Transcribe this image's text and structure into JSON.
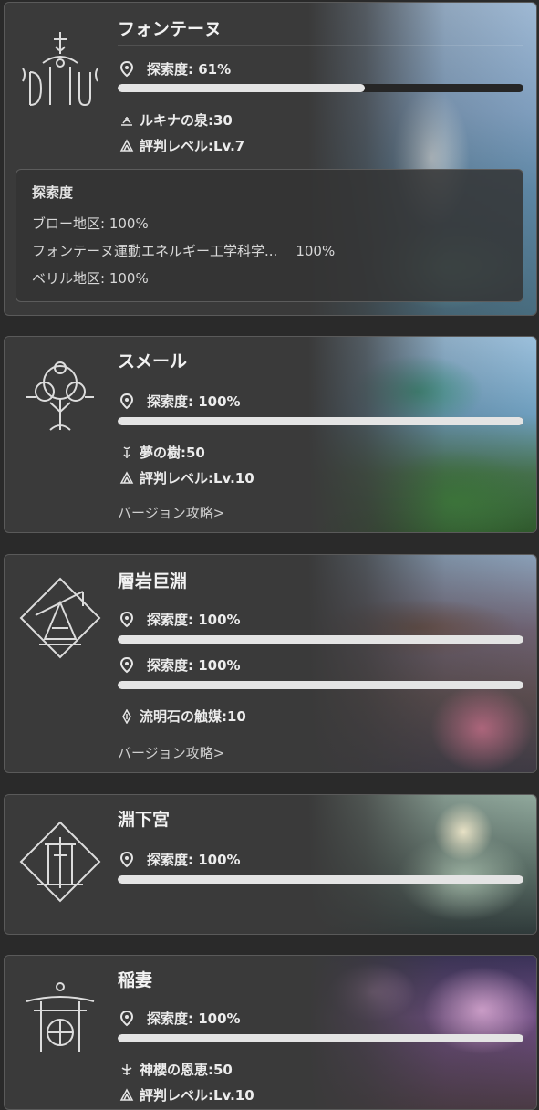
{
  "regions": [
    {
      "title": "フォンテーヌ",
      "exploration": [
        {
          "label": "探索度: 61%",
          "progress": 0.61
        }
      ],
      "stats": [
        {
          "icon": "lotus-fountain-icon",
          "label": "ルキナの泉: ",
          "value": "30"
        },
        {
          "icon": "reputation-icon",
          "label": "評判レベル: ",
          "value": "Lv.7"
        }
      ],
      "subareas": {
        "heading": "探索度",
        "rows": [
          {
            "name": "ブロー地区: 100%",
            "percent": ""
          },
          {
            "name": "フォンテーヌ運動エネルギー工学科学...",
            "percent": "100%"
          },
          {
            "name": "ベリル地区: 100%",
            "percent": ""
          }
        ]
      }
    },
    {
      "title": "スメール",
      "exploration": [
        {
          "label": "探索度: 100%",
          "progress": 1.0
        }
      ],
      "stats": [
        {
          "icon": "dream-tree-icon",
          "label": "夢の樹: ",
          "value": "50"
        },
        {
          "icon": "reputation-icon",
          "label": "評判レベル: ",
          "value": "Lv.10"
        }
      ],
      "link": "バージョン攻略>"
    },
    {
      "title": "層岩巨淵",
      "exploration": [
        {
          "label": "探索度: 100%",
          "progress": 1.0
        },
        {
          "label": "探索度: 100%",
          "progress": 1.0
        }
      ],
      "stats": [
        {
          "icon": "lumenstone-icon",
          "label": "流明石の触媒: ",
          "value": "10"
        }
      ],
      "link": "バージョン攻略>"
    },
    {
      "title": "淵下宮",
      "exploration": [
        {
          "label": "探索度: 100%",
          "progress": 1.0
        }
      ]
    },
    {
      "title": "稲妻",
      "exploration": [
        {
          "label": "探索度: 100%",
          "progress": 1.0
        }
      ],
      "stats": [
        {
          "icon": "sacred-sakura-icon",
          "label": "神櫻の恩恵: ",
          "value": "50"
        },
        {
          "icon": "reputation-icon",
          "label": "評判レベル: ",
          "value": "Lv.10"
        }
      ]
    }
  ],
  "colors": {
    "card_bg": "#3a3a3a",
    "card_border": "#5a5a5a",
    "bar_fill": "#e4e4e4",
    "bar_track": "#262626"
  }
}
